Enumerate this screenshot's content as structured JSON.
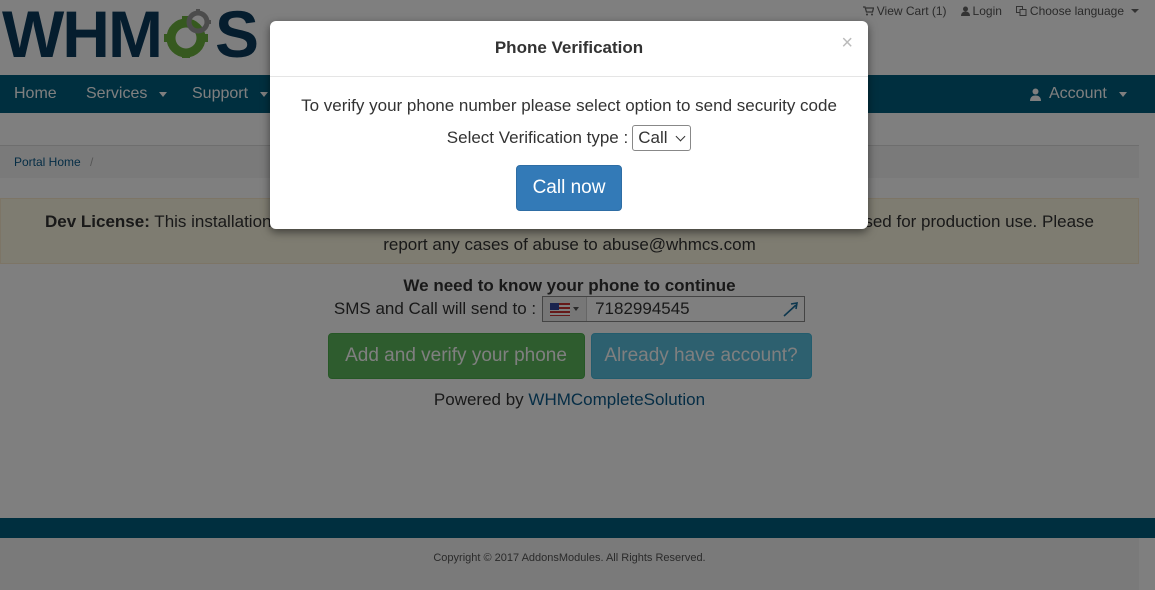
{
  "header": {
    "logo_text_left": "WHM",
    "logo_text_right": "S",
    "topbar": {
      "view_cart": "View Cart (1)",
      "login": "Login",
      "choose_language": "Choose language"
    }
  },
  "nav": {
    "items": [
      "Home",
      "Services",
      "Support"
    ],
    "account": "Account"
  },
  "breadcrumb": {
    "portal_home": "Portal Home",
    "separator": "/"
  },
  "alert": {
    "bold": "Dev License:",
    "text_start": " This installation c",
    "text_end": "sed for production use. Please",
    "line2": "report any cases of abuse to abuse@whmcs.com"
  },
  "content": {
    "need_phone": "We need to know your phone to continue",
    "sms_label": "SMS and Call will send to :",
    "phone_value": "7182994545",
    "add_verify_button": "Add and verify your phone",
    "already_account_button": "Already have account?",
    "powered_by": "Powered by ",
    "powered_link": "WHMCompleteSolution"
  },
  "footer": {
    "copyright": "Copyright © 2017 AddonsModules. All Rights Reserved."
  },
  "modal": {
    "title": "Phone Verification",
    "close": "×",
    "instruction": "To verify your phone number please select option to send security code",
    "select_label": "Select Verification type :",
    "select_value": "Call",
    "call_button": "Call now"
  },
  "colors": {
    "nav_bg": "#005e7f",
    "logo_dark": "#0b3a5c",
    "logo_gear": "#6cb33f",
    "btn_green": "#5cb85c",
    "btn_blue": "#5bc0de",
    "btn_primary": "#337ab7"
  }
}
